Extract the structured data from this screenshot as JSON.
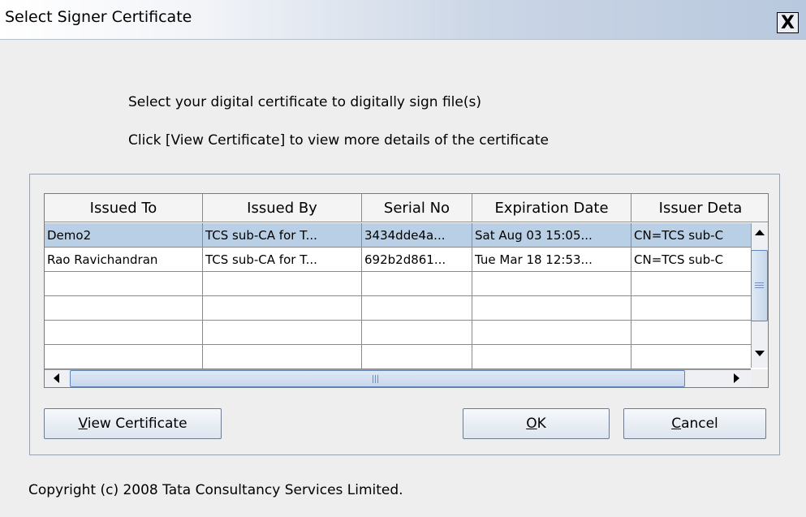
{
  "window": {
    "title": "Select Signer Certificate",
    "close_label": "X"
  },
  "instructions": [
    "Select your digital certificate to digitally sign file(s)",
    "Click [View Certificate] to view more details of the certificate"
  ],
  "table": {
    "columns": [
      "Issued To",
      "Issued By",
      "Serial No",
      "Expiration Date",
      "Issuer Deta"
    ],
    "rows": [
      [
        "Demo2",
        "TCS sub-CA for T...",
        "3434dde4a...",
        "Sat Aug 03 15:05...",
        "CN=TCS sub-C"
      ],
      [
        "Rao Ravichandran",
        "TCS sub-CA for T...",
        "692b2d861...",
        "Tue Mar 18 12:53...",
        "CN=TCS sub-C"
      ],
      [
        "",
        "",
        "",
        "",
        ""
      ],
      [
        "",
        "",
        "",
        "",
        ""
      ],
      [
        "",
        "",
        "",
        "",
        ""
      ],
      [
        "",
        "",
        "",
        "",
        ""
      ]
    ],
    "selected_row": 0
  },
  "buttons": {
    "view_certificate": {
      "mnemonic": "V",
      "rest": "iew Certificate"
    },
    "ok": {
      "mnemonic": "O",
      "rest": "K"
    },
    "cancel": {
      "mnemonic": "C",
      "rest": "ancel"
    }
  },
  "footer": {
    "copyright": "Copyright (c) 2008 Tata Consultancy Services Limited."
  },
  "colors": {
    "selection": "#b8cfe5",
    "accent": "#5f84b5"
  },
  "icons": {
    "close": "close-icon",
    "scroll_up": "arrow-up-icon",
    "scroll_down": "arrow-down-icon",
    "scroll_left": "arrow-left-icon",
    "scroll_right": "arrow-right-icon"
  }
}
